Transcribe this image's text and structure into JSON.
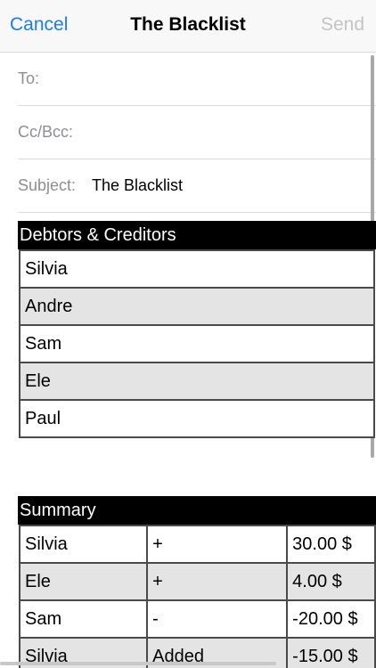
{
  "nav": {
    "cancel": "Cancel",
    "title": "The Blacklist",
    "send": "Send"
  },
  "fields": {
    "to_label": "To:",
    "cc_label": "Cc/Bcc:",
    "subject_label": "Subject:",
    "subject_value": "The Blacklist"
  },
  "debtors": {
    "header": "Debtors & Creditors",
    "rows": [
      "Silvia",
      "Andre",
      "Sam",
      "Ele",
      "Paul"
    ]
  },
  "summary": {
    "header": "Summary",
    "rows": [
      {
        "name": "Silvia",
        "sign": "+",
        "amount": "30.00 $"
      },
      {
        "name": "Ele",
        "sign": "+",
        "amount": "4.00 $"
      },
      {
        "name": "Sam",
        "sign": "-",
        "amount": "-20.00 $"
      },
      {
        "name": "Silvia",
        "sign": "Added",
        "amount": "-15.00 $"
      }
    ]
  },
  "colors": {
    "accent": "#1a7cf5",
    "disabled": "#c4c4c4",
    "label": "#8e8e93",
    "row_alt": "#e4e4e4"
  }
}
